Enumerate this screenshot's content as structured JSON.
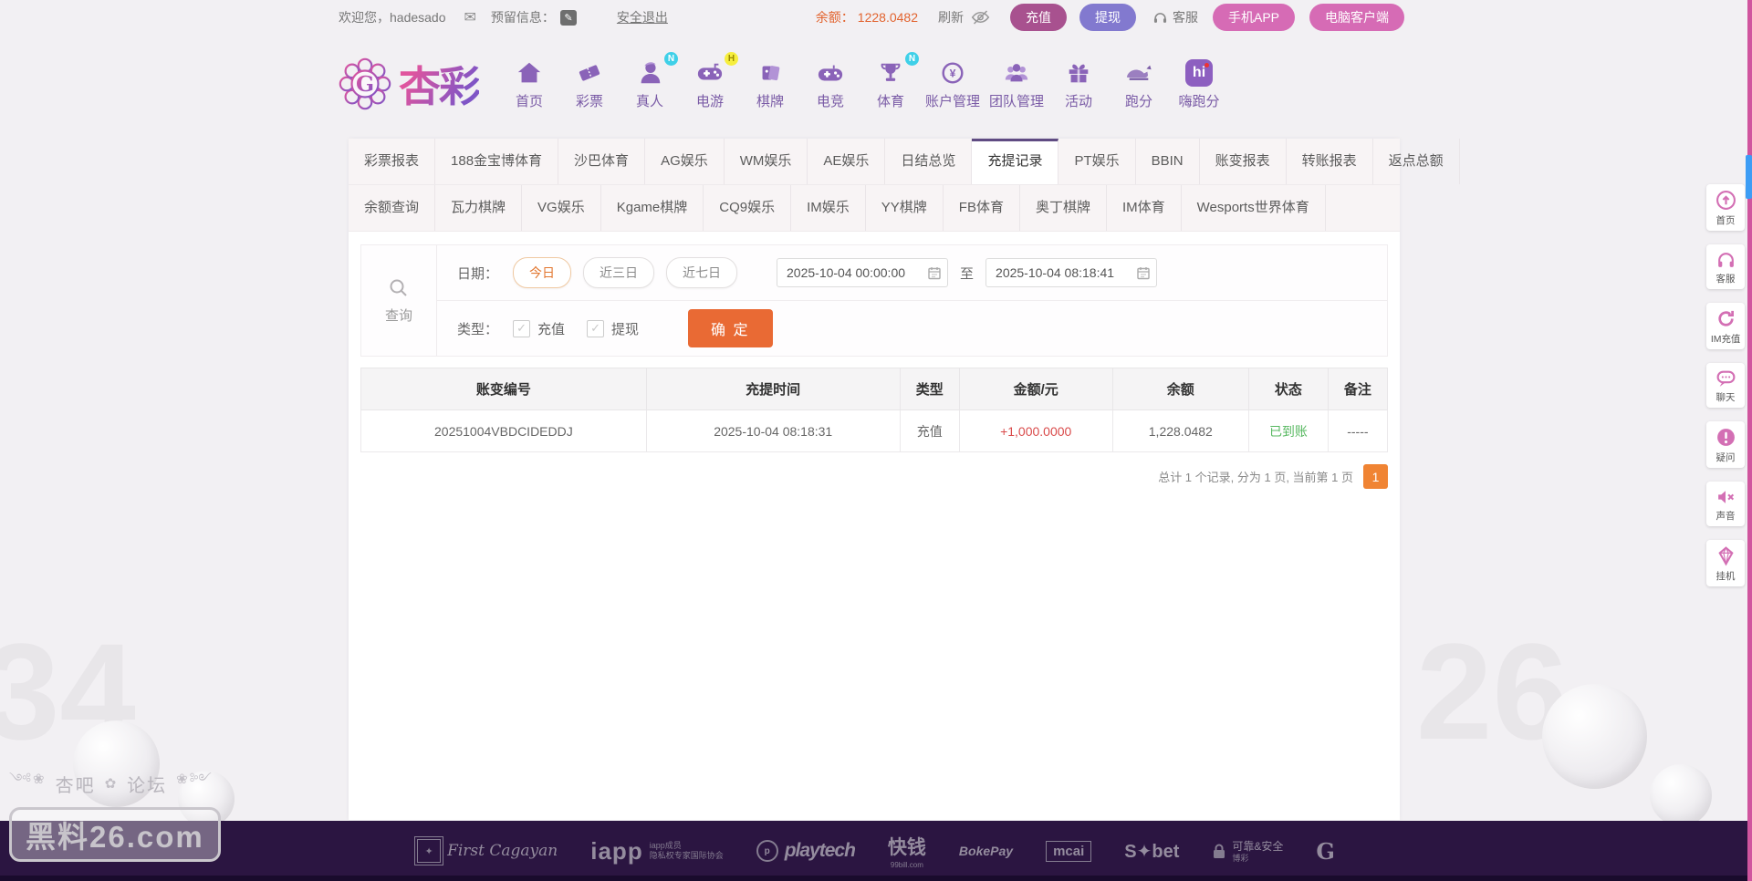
{
  "topbar": {
    "welcome": "欢迎您，hadesado",
    "reserved_label": "预留信息：",
    "logout_link": "安全退出",
    "balance_label": "余额：",
    "balance_value": "1228.0482",
    "refresh_label": "刷新",
    "service_label": "客服",
    "deposit_button": "充值",
    "withdraw_button": "提现",
    "mobile_app_button": "手机APP",
    "pc_client_button": "电脑客户端"
  },
  "logo": {
    "text": "杏彩"
  },
  "nav": {
    "items": [
      {
        "label": "首页",
        "icon": "home-icon"
      },
      {
        "label": "彩票",
        "icon": "ticket-icon"
      },
      {
        "label": "真人",
        "icon": "person-icon",
        "badge": "N"
      },
      {
        "label": "电游",
        "icon": "gamepad-icon",
        "badge": "H"
      },
      {
        "label": "棋牌",
        "icon": "cards-icon"
      },
      {
        "label": "电竞",
        "icon": "gamepad-icon"
      },
      {
        "label": "体育",
        "icon": "trophy-icon",
        "badge": "N"
      },
      {
        "label": "账户管理",
        "icon": "coin-yen-icon"
      },
      {
        "label": "团队管理",
        "icon": "people-icon"
      },
      {
        "label": "活动",
        "icon": "gift-icon"
      },
      {
        "label": "跑分",
        "icon": "rhino-icon"
      },
      {
        "label": "嗨跑分",
        "icon": "hi-icon"
      }
    ]
  },
  "tabs": {
    "row1": [
      "彩票报表",
      "188金宝博体育",
      "沙巴体育",
      "AG娱乐",
      "WM娱乐",
      "AE娱乐",
      "日结总览",
      "充提记录",
      "PT娱乐",
      "BBIN",
      "账变报表",
      "转账报表",
      "返点总额"
    ],
    "row2": [
      "余额查询",
      "瓦力棋牌",
      "VG娱乐",
      "Kgame棋牌",
      "CQ9娱乐",
      "IM娱乐",
      "YY棋牌",
      "FB体育",
      "奥丁棋牌",
      "IM体育",
      "Wesports世界体育"
    ],
    "active_tab": "充提记录"
  },
  "query": {
    "panel_label": "查询",
    "date_label": "日期：",
    "quick_today": "今日",
    "quick_3days": "近三日",
    "quick_7days": "近七日",
    "date_from": "2025-10-04 00:00:00",
    "to_label": "至",
    "date_to": "2025-10-04 08:18:41",
    "type_label": "类型：",
    "type_deposit": "充值",
    "type_withdraw": "提现",
    "submit_button": "确 定"
  },
  "table": {
    "headers": [
      "账变编号",
      "充提时间",
      "类型",
      "金额/元",
      "余额",
      "状态",
      "备注"
    ],
    "rows": [
      {
        "id": "20251004VBDCIDEDDJ",
        "time": "2025-10-04 08:18:31",
        "type": "充值",
        "amount": "+1,000.0000",
        "balance": "1,228.0482",
        "status": "已到账",
        "note": "-----"
      }
    ]
  },
  "pagination": {
    "summary": "总计 1 个记录, 分为 1 页, 当前第 1 页",
    "current_page": "1"
  },
  "side_rail": {
    "items": [
      {
        "label": "首页",
        "icon": "arrow-up-circle-icon"
      },
      {
        "label": "客服",
        "icon": "headset-icon"
      },
      {
        "label": "IM充值",
        "icon": "refresh-icon"
      },
      {
        "label": "聊天",
        "icon": "chat-bubble-icon"
      },
      {
        "label": "疑问",
        "icon": "exclamation-circle-icon"
      },
      {
        "label": "声音",
        "icon": "speaker-mute-icon"
      },
      {
        "label": "挂机",
        "icon": "diamond-icon"
      }
    ]
  },
  "footer": {
    "logos": [
      {
        "main": "First Cagayan",
        "sub": ""
      },
      {
        "main": "iapp",
        "sub": "iapp成员\n隐私权专家国际协会"
      },
      {
        "main": "playtech",
        "sub": ""
      },
      {
        "main": "快钱",
        "sub": "99bill.com"
      },
      {
        "main": "BokePay",
        "sub": ""
      },
      {
        "main": "mcai",
        "sub": ""
      },
      {
        "main": "S✦bet",
        "sub": ""
      },
      {
        "main": "可靠&安全",
        "sub": "博彩"
      },
      {
        "main": "G",
        "sub": ""
      }
    ]
  },
  "watermark": {
    "left_text": "杏吧",
    "right_text": "论坛",
    "box_text": "黑料26.com"
  },
  "background": {
    "digit_left": "34",
    "digit_right": "26"
  },
  "colors": {
    "page_bg": "#f2f0f3",
    "panel_bg": "#ffffff",
    "tabbar_bg": "#f8f4f5",
    "accent_purple": "#8a63b8",
    "nav_label_purple": "#7a5ba6",
    "active_tab_border": "#5f4b82",
    "deposit_btn": "#a8518f",
    "withdraw_btn": "#8279cf",
    "pink_btn": "#d66bb5",
    "submit_orange": "#e96a34",
    "balance_orange": "#e2632e",
    "quick_active_orange": "#e2762e",
    "amount_red": "#d94b4b",
    "status_green": "#57b860",
    "page_btn_orange": "#f08433",
    "footer_bg": "#2b1541",
    "edge_line_pink": "#d0559e",
    "scroll_thumb_blue": "#3d9df5"
  }
}
